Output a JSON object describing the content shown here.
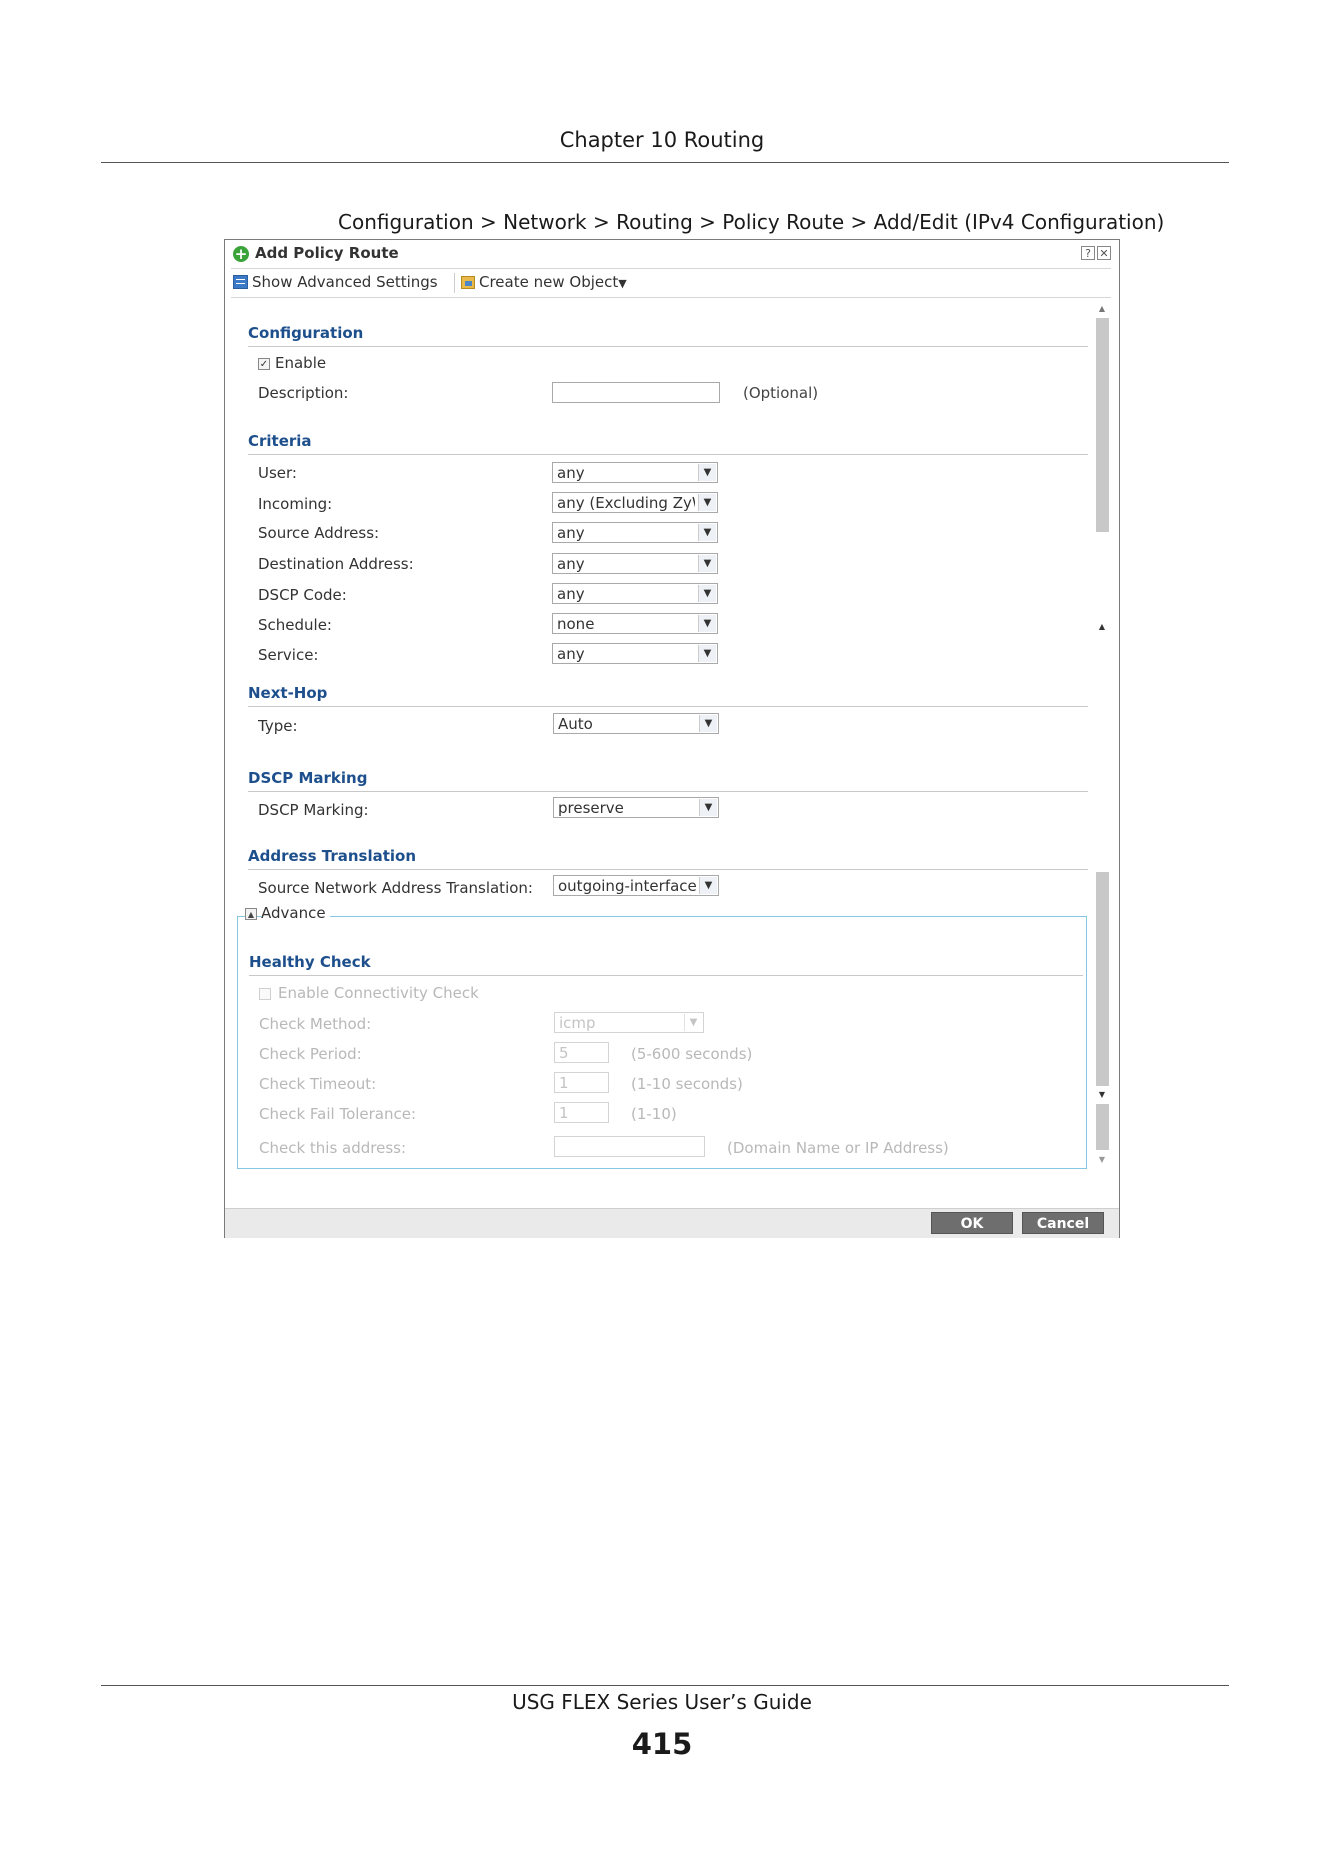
{
  "page": {
    "chapter": "Chapter 10 Routing",
    "figure_caption": "Configuration > Network > Routing > Policy Route > Add/Edit (IPv4 Configuration)",
    "footer_title": "USG FLEX Series User’s Guide",
    "page_number": "415"
  },
  "dialog": {
    "title": "Add Policy Route",
    "help_glyph": "?",
    "close_glyph": "✕",
    "toolbar": {
      "show_advanced": "Show Advanced Settings",
      "create_object": "Create new Object",
      "create_object_arrow": "▼"
    },
    "configuration": {
      "heading": "Configuration",
      "enable_label": "Enable",
      "enable_checked": true,
      "description_label": "Description:",
      "description_value": "",
      "description_hint": "(Optional)"
    },
    "criteria": {
      "heading": "Criteria",
      "rows": [
        {
          "label": "User:",
          "value": "any"
        },
        {
          "label": "Incoming:",
          "value": "any (Excluding ZyW"
        },
        {
          "label": "Source Address:",
          "value": "any"
        },
        {
          "label": "Destination Address:",
          "value": "any"
        },
        {
          "label": "DSCP Code:",
          "value": "any"
        },
        {
          "label": "Schedule:",
          "value": "none"
        },
        {
          "label": "Service:",
          "value": "any"
        }
      ]
    },
    "next_hop": {
      "heading": "Next-Hop",
      "type_label": "Type:",
      "type_value": "Auto"
    },
    "dscp_marking": {
      "heading": "DSCP Marking",
      "label": "DSCP Marking:",
      "value": "preserve"
    },
    "address_translation": {
      "heading": "Address Translation",
      "label": "Source Network Address Translation:",
      "value": "outgoing-interface"
    },
    "advance": {
      "label": "Advance",
      "toggle_glyph": "▲",
      "healthy_check": {
        "heading": "Healthy Check",
        "enable_label": "Enable Connectivity Check",
        "method_label": "Check Method:",
        "method_value": "icmp",
        "period_label": "Check Period:",
        "period_value": "5",
        "period_hint": "(5-600 seconds)",
        "timeout_label": "Check Timeout:",
        "timeout_value": "1",
        "timeout_hint": "(1-10 seconds)",
        "fail_label": "Check Fail Tolerance:",
        "fail_value": "1",
        "fail_hint": "(1-10)",
        "address_label": "Check this address:",
        "address_value": "",
        "address_hint": "(Domain Name or IP Address)"
      }
    },
    "buttons": {
      "ok": "OK",
      "cancel": "Cancel"
    },
    "dropdown_arrow": "▼"
  }
}
